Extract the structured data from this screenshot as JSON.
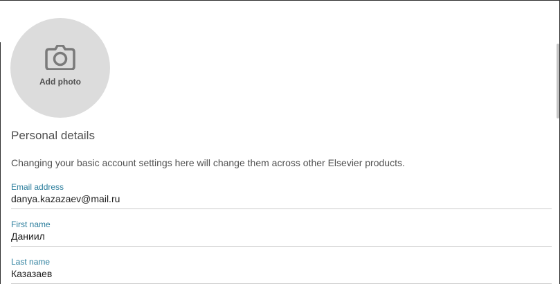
{
  "avatar": {
    "add_label": "Add photo",
    "icon": "camera-icon"
  },
  "personal_details": {
    "title": "Personal details",
    "description": "Changing your basic account settings here will change them across other Elsevier products."
  },
  "fields": {
    "email": {
      "label": "Email address",
      "value": "danya.kazazaev@mail.ru"
    },
    "first_name": {
      "label": "First name",
      "value": "Даниил"
    },
    "last_name": {
      "label": "Last name",
      "value": "Казазаев"
    }
  },
  "colors": {
    "label_accent": "#2a7d9c",
    "avatar_bg": "#dcdcdc",
    "divider": "#cccccc"
  }
}
